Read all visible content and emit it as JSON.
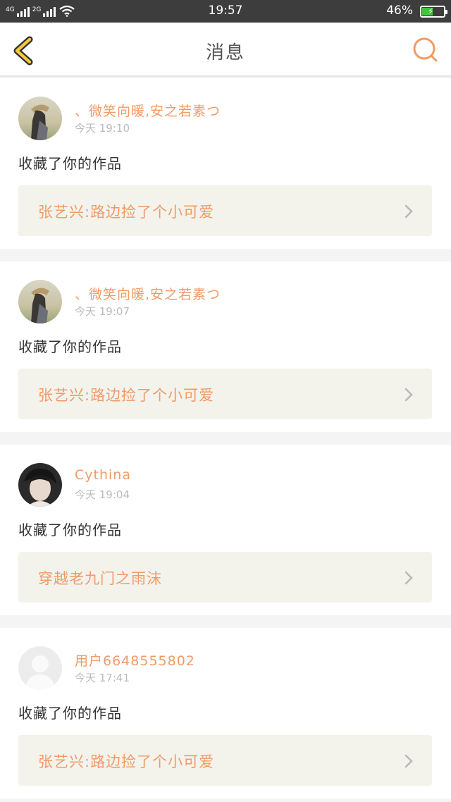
{
  "status_bar": {
    "network_1": "4G",
    "network_2": "2G",
    "time": "19:57",
    "battery_percent": "46%",
    "battery_level": 0.46,
    "battery_color": "#43c43a"
  },
  "header": {
    "title": "消息",
    "back_icon": "chevron-left-icon",
    "search_icon": "search-icon",
    "accent_color": "#f29a66"
  },
  "messages": [
    {
      "username": "、微笑向暖,安之若素つ",
      "time": "今天 19:10",
      "action": "收藏了你的作品",
      "work_title": "张艺兴:路边捡了个小可爱",
      "avatar_icon": "user-photo-icon"
    },
    {
      "username": "、微笑向暖,安之若素つ",
      "time": "今天 19:07",
      "action": "收藏了你的作品",
      "work_title": "张艺兴:路边捡了个小可爱",
      "avatar_icon": "user-photo-icon"
    },
    {
      "username": "Cythina",
      "time": "今天 19:04",
      "action": "收藏了你的作品",
      "work_title": "穿越老九门之雨沫",
      "avatar_icon": "user-photo-icon"
    },
    {
      "username": "用户6648555802",
      "time": "今天 17:41",
      "action": "收藏了你的作品",
      "work_title": "张艺兴:路边捡了个小可爱",
      "avatar_icon": "default-avatar-icon"
    }
  ]
}
